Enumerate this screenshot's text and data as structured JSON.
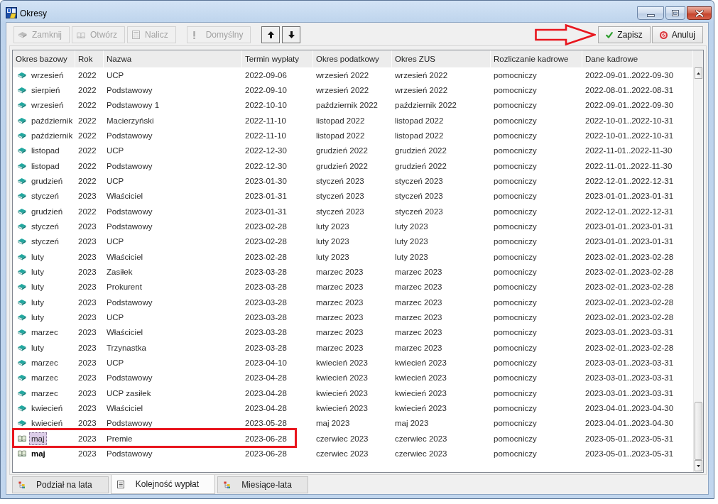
{
  "window": {
    "title": "Okresy"
  },
  "toolbar": {
    "groups": [
      {
        "buttons": [
          {
            "kind": "close",
            "label": "Zamknij",
            "disabled": true
          },
          {
            "kind": "open",
            "label": "Otwórz",
            "disabled": true
          },
          {
            "kind": "calculate",
            "label": "Nalicz",
            "disabled": true
          }
        ]
      },
      {
        "buttons": [
          {
            "kind": "default",
            "label": "Domyślny",
            "disabled": true
          }
        ]
      },
      {
        "buttons": [
          {
            "kind": "up",
            "disabled": false
          },
          {
            "kind": "down",
            "disabled": false
          }
        ]
      }
    ],
    "actions": [
      {
        "kind": "save",
        "label": "Zapisz",
        "disabled": false,
        "callout": true
      },
      {
        "kind": "cancel",
        "label": "Anuluj",
        "disabled": false,
        "callout": false
      }
    ]
  },
  "table": {
    "columns": [
      "Okres bazowy",
      "Rok",
      "Nazwa",
      "Termin wypłaty",
      "Okres podatkowy",
      "Okres ZUS",
      "Rozliczanie kadrowe",
      "Dane kadrowe"
    ],
    "rows": [
      {
        "kind": "closed",
        "selected": false,
        "current": false,
        "outlined": false,
        "cells": [
          "wrzesień",
          "2022",
          "UCP",
          "2022-09-06",
          "wrzesień 2022",
          "wrzesień 2022",
          "pomocniczy",
          "2022-09-01..2022-09-30"
        ]
      },
      {
        "kind": "closed",
        "selected": false,
        "current": false,
        "outlined": false,
        "cells": [
          "sierpień",
          "2022",
          "Podstawowy",
          "2022-09-10",
          "wrzesień 2022",
          "wrzesień 2022",
          "pomocniczy",
          "2022-08-01..2022-08-31"
        ]
      },
      {
        "kind": "closed",
        "selected": false,
        "current": false,
        "outlined": false,
        "cells": [
          "wrzesień",
          "2022",
          "Podstawowy 1",
          "2022-10-10",
          "październik 2022",
          "październik 2022",
          "pomocniczy",
          "2022-09-01..2022-09-30"
        ]
      },
      {
        "kind": "closed",
        "selected": false,
        "current": false,
        "outlined": false,
        "cells": [
          "październik",
          "2022",
          "Macierzyński",
          "2022-11-10",
          "listopad 2022",
          "listopad 2022",
          "pomocniczy",
          "2022-10-01..2022-10-31"
        ]
      },
      {
        "kind": "closed",
        "selected": false,
        "current": false,
        "outlined": false,
        "cells": [
          "październik",
          "2022",
          "Podstawowy",
          "2022-11-10",
          "listopad 2022",
          "listopad 2022",
          "pomocniczy",
          "2022-10-01..2022-10-31"
        ]
      },
      {
        "kind": "closed",
        "selected": false,
        "current": false,
        "outlined": false,
        "cells": [
          "listopad",
          "2022",
          "UCP",
          "2022-12-30",
          "grudzień 2022",
          "grudzień 2022",
          "pomocniczy",
          "2022-11-01..2022-11-30"
        ]
      },
      {
        "kind": "closed",
        "selected": false,
        "current": false,
        "outlined": false,
        "cells": [
          "listopad",
          "2022",
          "Podstawowy",
          "2022-12-30",
          "grudzień 2022",
          "grudzień 2022",
          "pomocniczy",
          "2022-11-01..2022-11-30"
        ]
      },
      {
        "kind": "closed",
        "selected": false,
        "current": false,
        "outlined": false,
        "cells": [
          "grudzień",
          "2022",
          "UCP",
          "2023-01-30",
          "styczeń 2023",
          "styczeń 2023",
          "pomocniczy",
          "2022-12-01..2022-12-31"
        ]
      },
      {
        "kind": "closed",
        "selected": false,
        "current": false,
        "outlined": false,
        "cells": [
          "styczeń",
          "2023",
          "Właściciel",
          "2023-01-31",
          "styczeń 2023",
          "styczeń 2023",
          "pomocniczy",
          "2023-01-01..2023-01-31"
        ]
      },
      {
        "kind": "closed",
        "selected": false,
        "current": false,
        "outlined": false,
        "cells": [
          "grudzień",
          "2022",
          "Podstawowy",
          "2023-01-31",
          "styczeń 2023",
          "styczeń 2023",
          "pomocniczy",
          "2022-12-01..2022-12-31"
        ]
      },
      {
        "kind": "closed",
        "selected": false,
        "current": false,
        "outlined": false,
        "cells": [
          "styczeń",
          "2023",
          "Podstawowy",
          "2023-02-28",
          "luty 2023",
          "luty 2023",
          "pomocniczy",
          "2023-01-01..2023-01-31"
        ]
      },
      {
        "kind": "closed",
        "selected": false,
        "current": false,
        "outlined": false,
        "cells": [
          "styczeń",
          "2023",
          "UCP",
          "2023-02-28",
          "luty 2023",
          "luty 2023",
          "pomocniczy",
          "2023-01-01..2023-01-31"
        ]
      },
      {
        "kind": "closed",
        "selected": false,
        "current": false,
        "outlined": false,
        "cells": [
          "luty",
          "2023",
          "Właściciel",
          "2023-02-28",
          "luty 2023",
          "luty 2023",
          "pomocniczy",
          "2023-02-01..2023-02-28"
        ]
      },
      {
        "kind": "closed",
        "selected": false,
        "current": false,
        "outlined": false,
        "cells": [
          "luty",
          "2023",
          "Zasiłek",
          "2023-03-28",
          "marzec 2023",
          "marzec 2023",
          "pomocniczy",
          "2023-02-01..2023-02-28"
        ]
      },
      {
        "kind": "closed",
        "selected": false,
        "current": false,
        "outlined": false,
        "cells": [
          "luty",
          "2023",
          "Prokurent",
          "2023-03-28",
          "marzec 2023",
          "marzec 2023",
          "pomocniczy",
          "2023-02-01..2023-02-28"
        ]
      },
      {
        "kind": "closed",
        "selected": false,
        "current": false,
        "outlined": false,
        "cells": [
          "luty",
          "2023",
          "Podstawowy",
          "2023-03-28",
          "marzec 2023",
          "marzec 2023",
          "pomocniczy",
          "2023-02-01..2023-02-28"
        ]
      },
      {
        "kind": "closed",
        "selected": false,
        "current": false,
        "outlined": false,
        "cells": [
          "luty",
          "2023",
          "UCP",
          "2023-03-28",
          "marzec 2023",
          "marzec 2023",
          "pomocniczy",
          "2023-02-01..2023-02-28"
        ]
      },
      {
        "kind": "closed",
        "selected": false,
        "current": false,
        "outlined": false,
        "cells": [
          "marzec",
          "2023",
          "Właściciel",
          "2023-03-28",
          "marzec 2023",
          "marzec 2023",
          "pomocniczy",
          "2023-03-01..2023-03-31"
        ]
      },
      {
        "kind": "closed",
        "selected": false,
        "current": false,
        "outlined": false,
        "cells": [
          "luty",
          "2023",
          "Trzynastka",
          "2023-03-28",
          "marzec 2023",
          "marzec 2023",
          "pomocniczy",
          "2023-02-01..2023-02-28"
        ]
      },
      {
        "kind": "closed",
        "selected": false,
        "current": false,
        "outlined": false,
        "cells": [
          "marzec",
          "2023",
          "UCP",
          "2023-04-10",
          "kwiecień 2023",
          "kwiecień 2023",
          "pomocniczy",
          "2023-03-01..2023-03-31"
        ]
      },
      {
        "kind": "closed",
        "selected": false,
        "current": false,
        "outlined": false,
        "cells": [
          "marzec",
          "2023",
          "Podstawowy",
          "2023-04-28",
          "kwiecień 2023",
          "kwiecień 2023",
          "pomocniczy",
          "2023-03-01..2023-03-31"
        ]
      },
      {
        "kind": "closed",
        "selected": false,
        "current": false,
        "outlined": false,
        "cells": [
          "marzec",
          "2023",
          "UCP zasiłek",
          "2023-04-28",
          "kwiecień 2023",
          "kwiecień 2023",
          "pomocniczy",
          "2023-03-01..2023-03-31"
        ]
      },
      {
        "kind": "closed",
        "selected": false,
        "current": false,
        "outlined": false,
        "cells": [
          "kwiecień",
          "2023",
          "Właściciel",
          "2023-04-28",
          "kwiecień 2023",
          "kwiecień 2023",
          "pomocniczy",
          "2023-04-01..2023-04-30"
        ]
      },
      {
        "kind": "closed",
        "selected": false,
        "current": false,
        "outlined": false,
        "cells": [
          "kwiecień",
          "2023",
          "Podstawowy",
          "2023-05-28",
          "maj 2023",
          "maj 2023",
          "pomocniczy",
          "2023-04-01..2023-04-30"
        ]
      },
      {
        "kind": "open",
        "selected": true,
        "current": false,
        "outlined": true,
        "cells": [
          "maj",
          "2023",
          "Premie",
          "2023-06-28",
          "czerwiec 2023",
          "czerwiec 2023",
          "pomocniczy",
          "2023-05-01..2023-05-31"
        ]
      },
      {
        "kind": "open",
        "selected": false,
        "current": true,
        "outlined": false,
        "cells": [
          "maj",
          "2023",
          "Podstawowy",
          "2023-06-28",
          "czerwiec 2023",
          "czerwiec 2023",
          "pomocniczy",
          "2023-05-01..2023-05-31"
        ]
      }
    ]
  },
  "tabs": [
    {
      "kind": "tree",
      "label": "Podział na lata",
      "selected": false
    },
    {
      "kind": "list",
      "label": "Kolejność wypłat",
      "selected": true
    },
    {
      "kind": "tree",
      "label": "Miesiące-lata",
      "selected": false
    }
  ]
}
